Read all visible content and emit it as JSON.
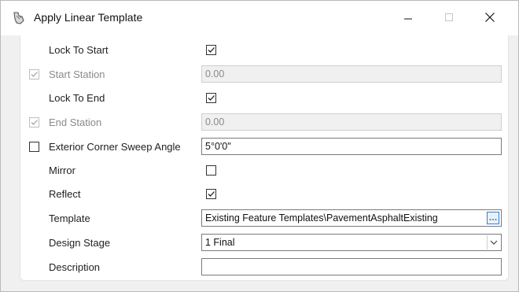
{
  "window": {
    "title": "Apply Linear Template",
    "icon": "template-tool-icon",
    "controls": {
      "minimize": "–",
      "close": "✕"
    }
  },
  "rows": {
    "lock_to_start": {
      "label": "Lock To Start",
      "checked": true
    },
    "start_station": {
      "label": "Start Station",
      "value": "0.00",
      "enabled_checked": true
    },
    "lock_to_end": {
      "label": "Lock To End",
      "checked": true
    },
    "end_station": {
      "label": "End Station",
      "value": "0.00",
      "enabled_checked": true
    },
    "corner_sweep": {
      "label": "Exterior Corner Sweep Angle",
      "value": "5°0'0\"",
      "enabled_checked": false
    },
    "mirror": {
      "label": "Mirror",
      "checked": false
    },
    "reflect": {
      "label": "Reflect",
      "checked": true
    },
    "template": {
      "label": "Template",
      "value": "Existing Feature Templates\\PavementAsphaltExisting"
    },
    "design_stage": {
      "label": "Design Stage",
      "value": "1 Final"
    },
    "description": {
      "label": "Description",
      "value": ""
    }
  },
  "colors": {
    "accent": "#2f7fd3",
    "disabled_text": "#8a8a8a"
  }
}
